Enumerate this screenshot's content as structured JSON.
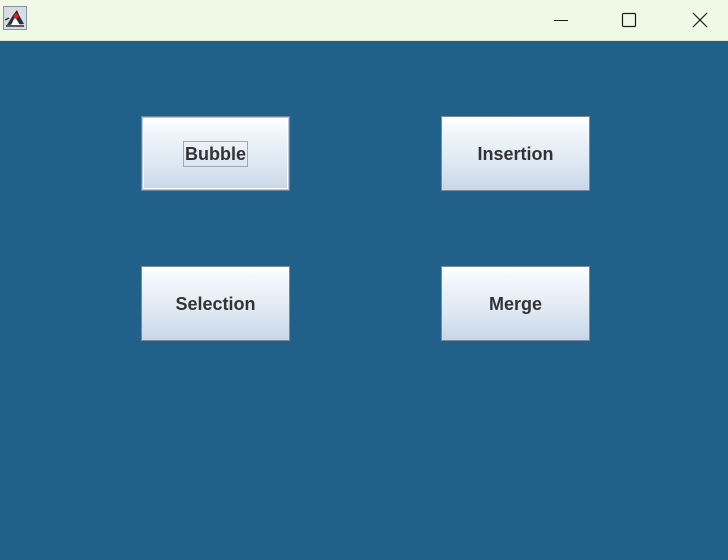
{
  "window": {
    "title": "",
    "app_icon": "java-duke-icon",
    "controls": {
      "minimize_icon": "minimize-icon",
      "maximize_icon": "maximize-icon",
      "close_icon": "close-icon"
    }
  },
  "colors": {
    "titlebar_bg": "#eff9e5",
    "content_bg": "#216189",
    "button_text": "#333333"
  },
  "buttons": {
    "bubble": "Bubble",
    "insertion": "Insertion",
    "selection": "Selection",
    "merge": "Merge"
  },
  "focused_button": "bubble"
}
